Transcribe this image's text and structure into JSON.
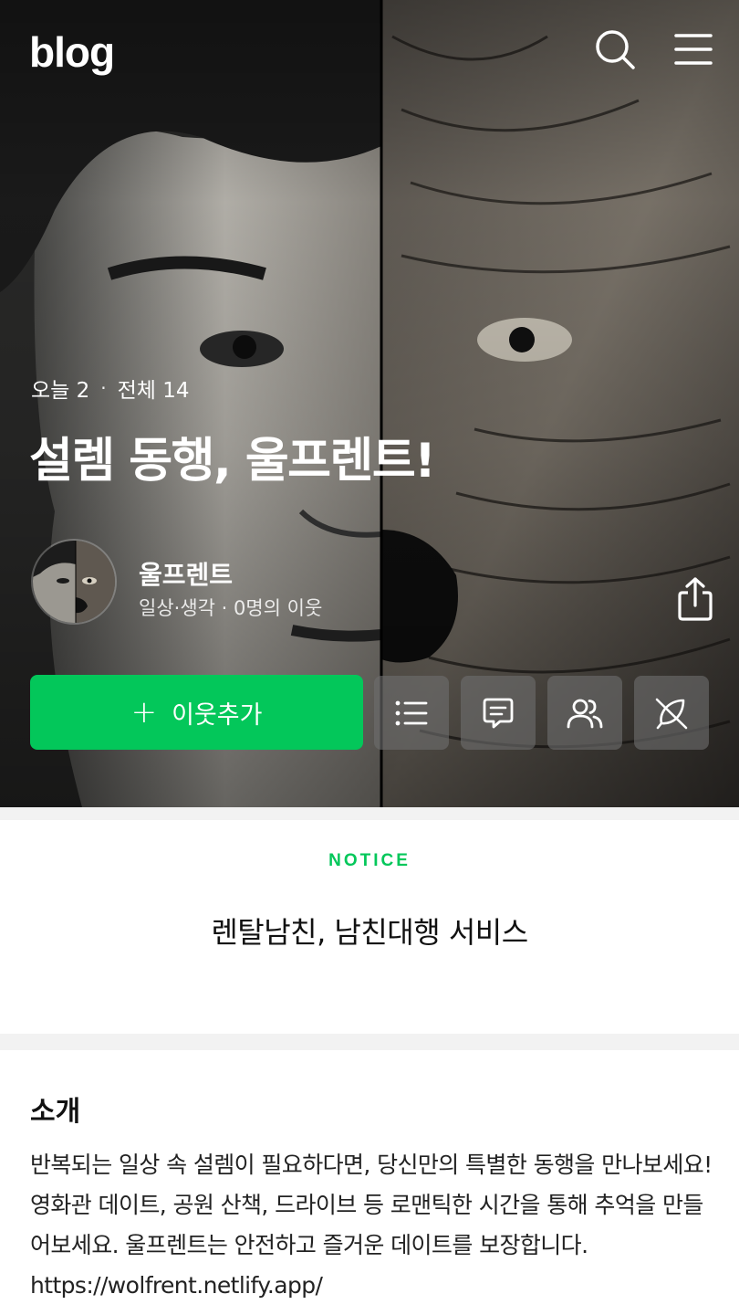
{
  "header": {
    "logo": "blog",
    "search_icon": "search-icon",
    "menu_icon": "hamburger-menu-icon"
  },
  "profile": {
    "stats": {
      "today": "오늘 2",
      "separator": "·",
      "total": "전체 14"
    },
    "blog_title": "설렘 동행, 울프렌트!",
    "owner_name": "울프렌트",
    "owner_meta": "일상·생각 · 0명의 이웃",
    "share_icon": "share-icon"
  },
  "actions": {
    "add_neighbor_label": "이웃추가",
    "buttons": [
      "list-icon",
      "guestbook-icon",
      "neighbors-icon",
      "write-disabled-icon"
    ],
    "accent_color": "#03c75a"
  },
  "notice": {
    "tag": "NOTICE",
    "text": "렌탈남친, 남친대행 서비스"
  },
  "intro": {
    "heading": "소개",
    "body": "반복되는 일상 속 설렘이 필요하다면, 당신만의 특별한 동행을 만나보세요! 영화관 데이트, 공원 산책, 드라이브 등 로맨틱한 시간을 통해 추억을 만들어보세요. 울프렌트는 안전하고 즐거운 데이트를 보장합니다. https://wolfrent.netlify.app/"
  }
}
